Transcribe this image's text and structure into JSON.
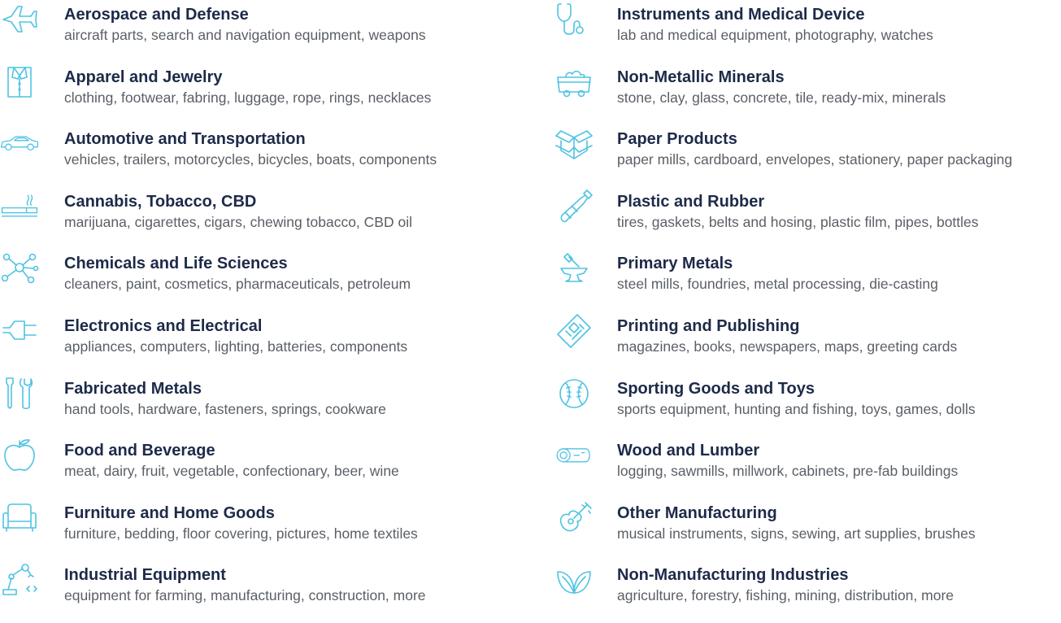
{
  "icon_color": "#4fc3e3",
  "title_color": "#1d2a49",
  "desc_color": "#5a5f66",
  "left_column": [
    {
      "icon": "airplane-icon",
      "title": "Aerospace and Defense",
      "desc": "aircraft parts, search and navigation equipment, weapons"
    },
    {
      "icon": "shirt-icon",
      "title": "Apparel and Jewelry",
      "desc": "clothing, footwear, fabring, luggage, rope, rings, necklaces"
    },
    {
      "icon": "car-icon",
      "title": "Automotive and Transportation",
      "desc": "vehicles, trailers, motorcycles, bicycles, boats, components"
    },
    {
      "icon": "cigarette-icon",
      "title": "Cannabis, Tobacco, CBD",
      "desc": "marijuana, cigarettes, cigars, chewing tobacco, CBD oil"
    },
    {
      "icon": "molecule-icon",
      "title": "Chemicals and Life Sciences",
      "desc": "cleaners, paint, cosmetics, pharmaceuticals, petroleum"
    },
    {
      "icon": "plug-icon",
      "title": "Electronics and Electrical",
      "desc": "appliances, computers, lighting, batteries, components"
    },
    {
      "icon": "tools-icon",
      "title": "Fabricated Metals",
      "desc": "hand tools, hardware, fasteners, springs, cookware"
    },
    {
      "icon": "apple-icon",
      "title": "Food and Beverage",
      "desc": "meat, dairy, fruit, vegetable, confectionary, beer, wine"
    },
    {
      "icon": "armchair-icon",
      "title": "Furniture and Home Goods",
      "desc": "furniture, bedding, floor covering, pictures, home textiles"
    },
    {
      "icon": "robot-arm-icon",
      "title": "Industrial Equipment",
      "desc": "equipment for farming, manufacturing, construction, more"
    }
  ],
  "right_column": [
    {
      "icon": "stethoscope-icon",
      "title": "Instruments and Medical Device",
      "desc": "lab and medical equipment, photography, watches"
    },
    {
      "icon": "mine-cart-icon",
      "title": "Non-Metallic Minerals",
      "desc": "stone, clay, glass, concrete, tile, ready-mix, minerals"
    },
    {
      "icon": "box-icon",
      "title": "Paper Products",
      "desc": "paper mills, cardboard, envelopes, stationery, paper packaging"
    },
    {
      "icon": "bottle-icon",
      "title": "Plastic and Rubber",
      "desc": "tires, gaskets, belts and hosing, plastic film, pipes, bottles"
    },
    {
      "icon": "anvil-icon",
      "title": "Primary Metals",
      "desc": "steel mills, foundries, metal processing, die-casting"
    },
    {
      "icon": "newspaper-icon",
      "title": "Printing and Publishing",
      "desc": "magazines, books, newspapers, maps, greeting cards"
    },
    {
      "icon": "baseball-icon",
      "title": "Sporting Goods and Toys",
      "desc": "sports equipment, hunting and fishing, toys, games, dolls"
    },
    {
      "icon": "log-icon",
      "title": "Wood and Lumber",
      "desc": "logging, sawmills, millwork, cabinets, pre-fab buildings"
    },
    {
      "icon": "guitar-icon",
      "title": "Other Manufacturing",
      "desc": "musical instruments, signs, sewing, art supplies, brushes"
    },
    {
      "icon": "leaves-icon",
      "title": "Non-Manufacturing Industries",
      "desc": "agriculture, forestry, fishing, mining, distribution, more"
    }
  ]
}
